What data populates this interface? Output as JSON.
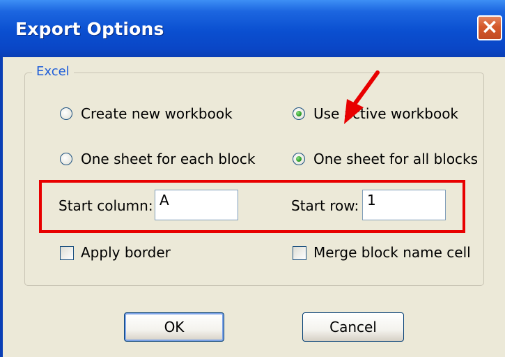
{
  "window": {
    "title": "Export Options",
    "close_icon": "×"
  },
  "group": {
    "label": "Excel"
  },
  "radios": {
    "create_new": {
      "label": "Create new workbook",
      "checked": false
    },
    "use_active": {
      "label": "Use active workbook",
      "checked": true
    },
    "one_each": {
      "label": "One sheet for each block",
      "checked": false
    },
    "one_all": {
      "label": "One sheet for all blocks",
      "checked": true
    }
  },
  "fields": {
    "start_column": {
      "label": "Start column:",
      "value": "A"
    },
    "start_row": {
      "label": "Start row:",
      "value": "1"
    }
  },
  "checkboxes": {
    "apply_border": {
      "label": "Apply border",
      "checked": false
    },
    "merge_block": {
      "label": "Merge block name cell",
      "checked": false
    }
  },
  "buttons": {
    "ok": "OK",
    "cancel": "Cancel"
  },
  "annotation": {
    "color": "#e80000"
  }
}
